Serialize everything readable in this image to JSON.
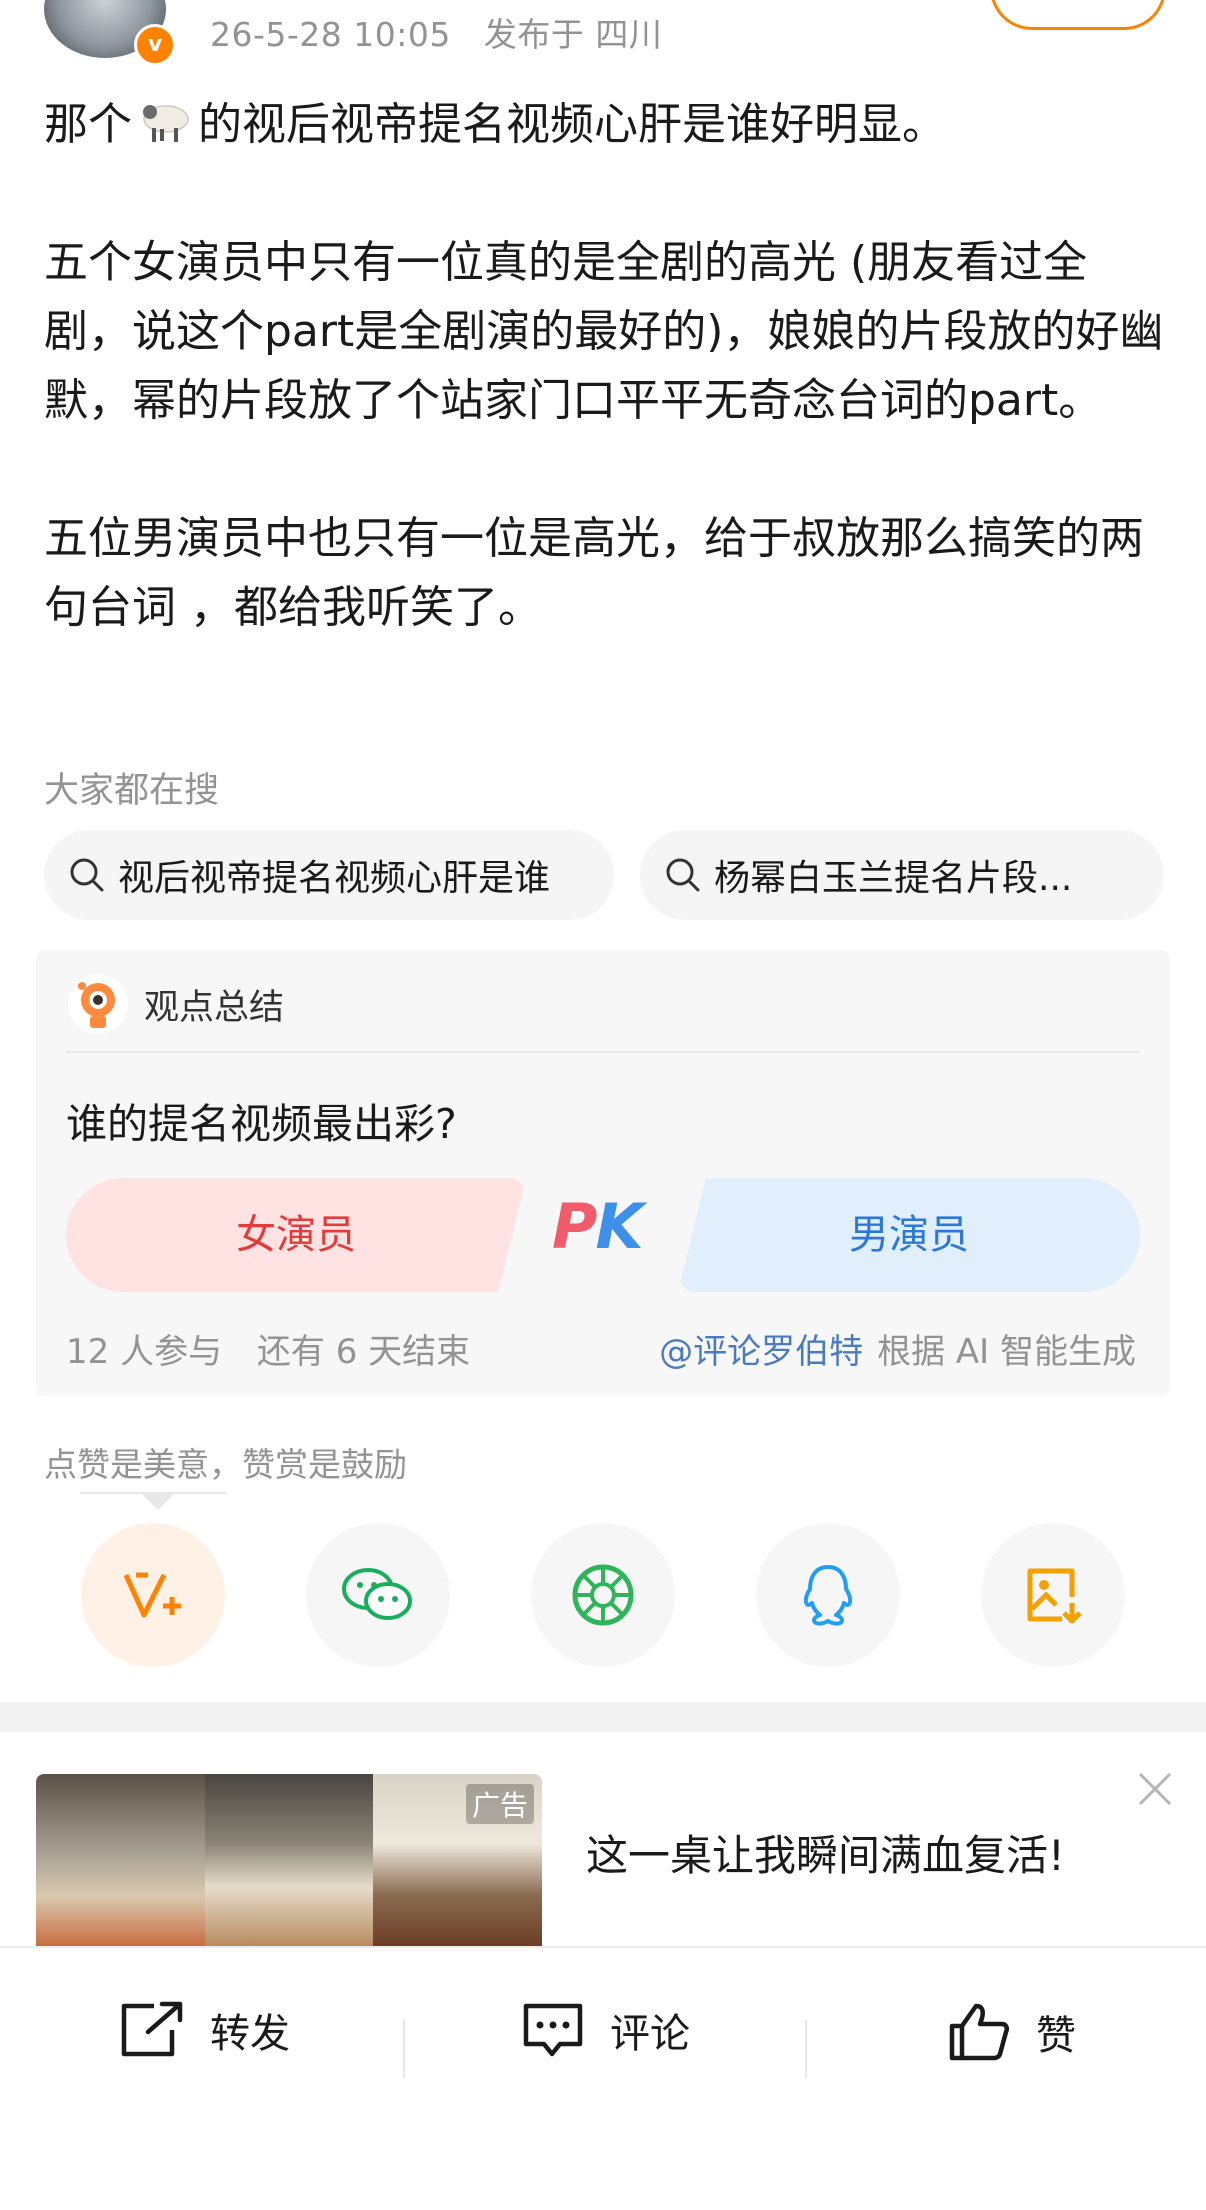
{
  "post_header": {
    "timestamp": "26-5-28 10:05",
    "location": "发布于 四川"
  },
  "post": {
    "p1_before": "那个",
    "p1_after": "的视后视帝提名视频心肝是谁好明显。",
    "p2": "五个女演员中只有一位真的是全剧的高光 (朋友看过全剧，说这个part是全剧演的最好的)，娘娘的片段放的好幽默，幂的片段放了个站家门口平平无奇念台词的part。",
    "p3": "五位男演员中也只有一位是高光，给于叔放那么搞笑的两句台词 ，都给我听笑了。"
  },
  "search": {
    "label": "大家都在搜",
    "chips": [
      {
        "text": "视后视帝提名视频心肝是谁"
      },
      {
        "text": "杨幂白玉兰提名片段..."
      }
    ]
  },
  "opinion_card": {
    "title": "观点总结",
    "question": "谁的提名视频最出彩?",
    "left_option": "女演员",
    "right_option": "男演员",
    "pk_p": "P",
    "pk_k": "K",
    "participants": "12 人参与",
    "remaining": "还有 6 天结束",
    "author": "@评论罗伯特",
    "generated_note": "根据 AI 智能生成",
    "colors": {
      "left": "#ffe2e2",
      "right": "#e1eefc"
    }
  },
  "reward": {
    "label": "点赞是美意，赞赏是鼓励",
    "share_buttons": [
      {
        "icon": "reward-v-plus-icon"
      },
      {
        "icon": "wechat-icon"
      },
      {
        "icon": "moments-icon"
      },
      {
        "icon": "qq-icon"
      },
      {
        "icon": "save-image-icon"
      }
    ]
  },
  "ad": {
    "tag": "广告",
    "title": "这一桌让我瞬间满血复活!"
  },
  "bottom_bar": {
    "repost": "转发",
    "comment": "评论",
    "like": "赞"
  },
  "colors": {
    "accent_orange": "#ff8200",
    "meta_gray": "#939393",
    "link_blue": "#4a7bbd"
  }
}
